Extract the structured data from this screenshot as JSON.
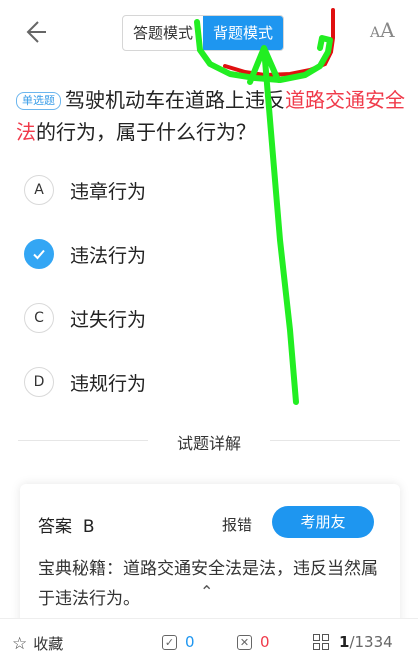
{
  "header": {
    "modes": [
      "答题模式",
      "背题模式"
    ],
    "active_mode": "背题模式",
    "font_icon": "A",
    "font_icon_small": "A"
  },
  "question": {
    "type_badge": "单选题",
    "text_pre": "驾驶机动车在道路上违反",
    "text_highlight": "道路交通安全法",
    "text_post": "的行为，属于什么行为？"
  },
  "options": [
    {
      "letter": "A",
      "text": "违章行为",
      "checked": false
    },
    {
      "letter": "B",
      "text": "违法行为",
      "checked": true
    },
    {
      "letter": "C",
      "text": "过失行为",
      "checked": false
    },
    {
      "letter": "D",
      "text": "违规行为",
      "checked": false
    }
  ],
  "detail": {
    "title": "试题详解",
    "answer_label": "答案",
    "answer_value": "B",
    "report_label": "报错",
    "friend_button": "考朋友",
    "tips": "宝典秘籍：道路交通安全法是法，违反当然属于违法行为。"
  },
  "bottom_bar": {
    "favorite_label": "收藏",
    "correct_count": "0",
    "wrong_count": "0",
    "progress_current": "1",
    "progress_total": "/1334"
  },
  "colors": {
    "accent": "#1e96f0",
    "highlight": "#f03a4a",
    "correct": "#33a6f4",
    "wrong": "#f03a4a",
    "annotation_green": "#22ee22",
    "annotation_red": "#e01010"
  }
}
